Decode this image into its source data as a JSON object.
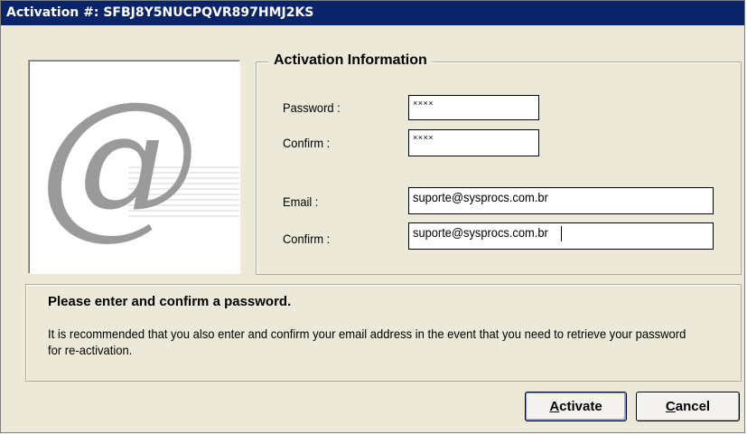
{
  "window": {
    "title": "Activation #: SFBJ8Y5NUCPQVR897HMJ2KS"
  },
  "logo": {
    "icon": "at-sign-icon",
    "glyph": "@"
  },
  "activation_info": {
    "legend": "Activation Information",
    "password_label": "Password :",
    "password_value": "××××",
    "confirm_password_label": "Confirm :",
    "confirm_password_value": "××××",
    "email_label": "Email :",
    "email_value": "suporte@sysprocs.com.br",
    "confirm_email_label": "Confirm :",
    "confirm_email_value": "suporte@sysprocs.com.br"
  },
  "info": {
    "title": "Please enter and confirm a password.",
    "text": "It is recommended that you also enter and confirm your email address in the event that you need to retrieve your password for re-activation."
  },
  "buttons": {
    "activate_mnemonic": "A",
    "activate_rest": "ctivate",
    "cancel_mnemonic": "C",
    "cancel_rest": "ancel"
  },
  "colors": {
    "titlebar": "#0a246a",
    "dialog_bg": "#ece9d8",
    "logo_glyph": "#9a9a9a"
  }
}
